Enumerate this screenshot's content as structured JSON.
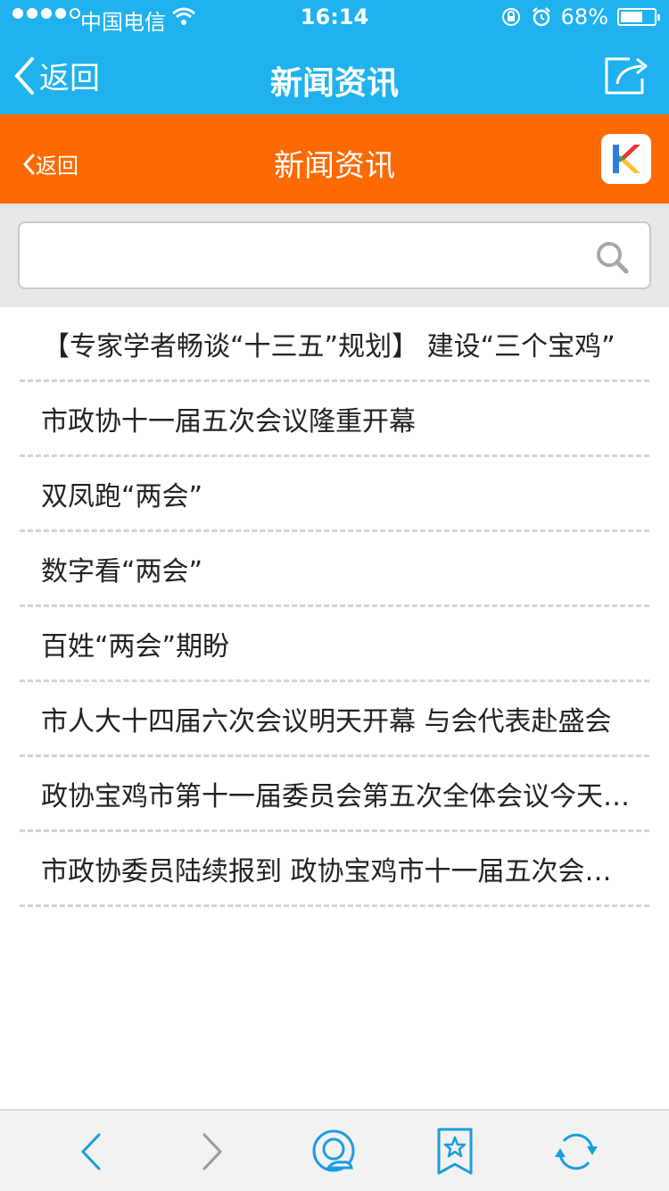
{
  "status_bar": {
    "carrier": "中国电信",
    "time": "16:14",
    "battery": "68%",
    "battery_level": 0.68
  },
  "nav_primary": {
    "back_label": "返回",
    "title": "新闻资讯"
  },
  "nav_secondary": {
    "back_label": "返回",
    "title": "新闻资讯"
  },
  "search": {
    "placeholder": "",
    "value": ""
  },
  "news": [
    {
      "title": "【专家学者畅谈“十三五”规划】 建设“三个宝鸡”"
    },
    {
      "title": "市政协十一届五次会议隆重开幕"
    },
    {
      "title": "双凤跑“两会”"
    },
    {
      "title": "数字看“两会”"
    },
    {
      "title": "百姓“两会”期盼"
    },
    {
      "title": "市人大十四届六次会议明天开幕 与会代表赴盛会"
    },
    {
      "title": "政协宝鸡市第十一届委员会第五次全体会议今天…"
    },
    {
      "title": "市政协委员陆续报到  政协宝鸡市十一届五次会…"
    }
  ],
  "toolbar": {
    "icons": [
      "back-arrow-icon",
      "forward-arrow-icon",
      "cloud-chat-icon",
      "bookmark-star-icon",
      "refresh-icon"
    ]
  },
  "colors": {
    "primary_blue": "#1fb2ee",
    "orange_bar": "#fd6a02",
    "toolbar_icon": "#1a9de0"
  }
}
